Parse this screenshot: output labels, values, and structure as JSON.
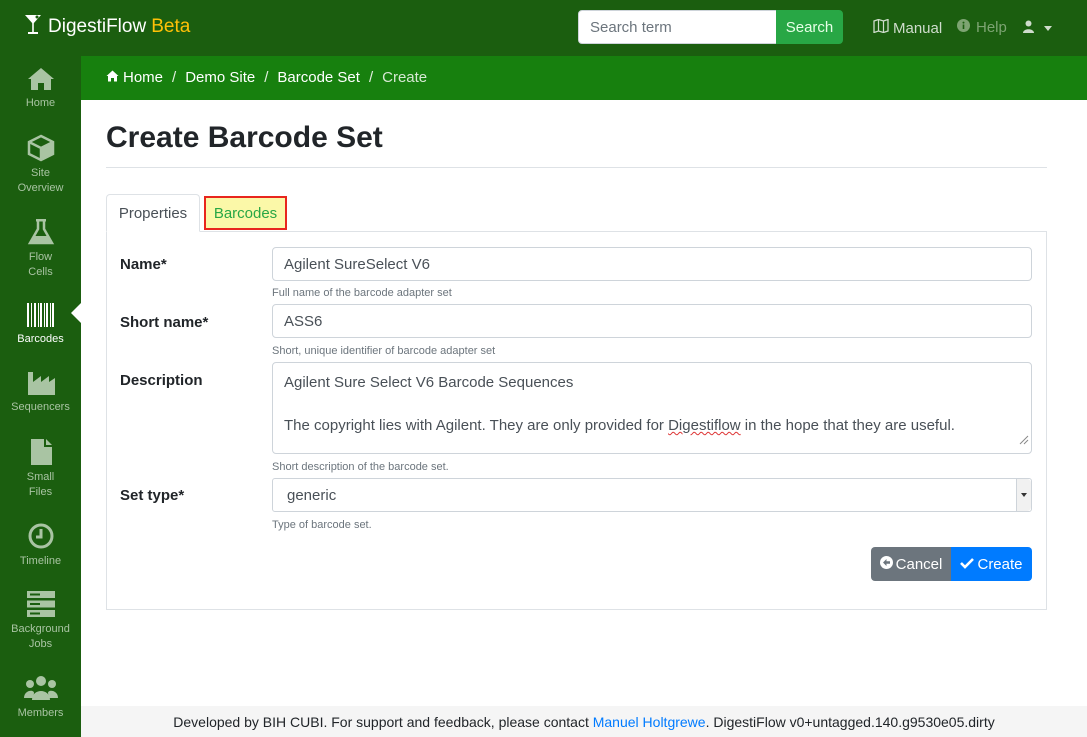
{
  "app": {
    "name": "DigestiFlow",
    "badge": "Beta"
  },
  "search": {
    "placeholder": "Search term",
    "button": "Search"
  },
  "topnav": {
    "manual": "Manual",
    "help": "Help"
  },
  "sidebar": {
    "items": [
      {
        "label1": "Home",
        "label2": "",
        "icon": "home-icon"
      },
      {
        "label1": "Site",
        "label2": "Overview",
        "icon": "cube-icon"
      },
      {
        "label1": "Flow",
        "label2": "Cells",
        "icon": "flask-icon"
      },
      {
        "label1": "Barcodes",
        "label2": "",
        "icon": "barcode-icon",
        "active": true
      },
      {
        "label1": "Sequencers",
        "label2": "",
        "icon": "industry-icon"
      },
      {
        "label1": "Small",
        "label2": "Files",
        "icon": "file-icon"
      },
      {
        "label1": "Timeline",
        "label2": "",
        "icon": "clock-icon"
      },
      {
        "label1": "Background",
        "label2": "Jobs",
        "icon": "server-icon"
      },
      {
        "label1": "Members",
        "label2": "",
        "icon": "users-icon"
      }
    ]
  },
  "breadcrumb": [
    "Home",
    "Demo Site",
    "Barcode Set",
    "Create"
  ],
  "page": {
    "title": "Create Barcode Set"
  },
  "tabs": {
    "properties": "Properties",
    "barcodes": "Barcodes"
  },
  "form": {
    "name": {
      "label": "Name*",
      "value": "Agilent SureSelect V6",
      "help": "Full name of the barcode adapter set"
    },
    "short_name": {
      "label": "Short name*",
      "value": "ASS6",
      "help": "Short, unique identifier of barcode adapter set"
    },
    "description": {
      "label": "Description",
      "line1": "Agilent Sure Select V6 Barcode Sequences",
      "line2_pre": "The copyright lies with Agilent. They are only provided for ",
      "line2_word": "Digestiflow",
      "line2_post": " in the hope that they are useful.",
      "help": "Short description of the barcode set."
    },
    "set_type": {
      "label": "Set type*",
      "value": "generic",
      "help": "Type of barcode set."
    }
  },
  "buttons": {
    "cancel": "Cancel",
    "create": "Create"
  },
  "footer": {
    "pre": "Developed by BIH CUBI. For support and feedback, please contact ",
    "link": "Manuel Holtgrewe",
    "post": ". DigestiFlow v0+untagged.140.g9530e05.dirty"
  },
  "colors": {
    "navbar": "#1b5e0f",
    "breadcrumb_bar": "#17800e",
    "brand_badge": "#ffc107",
    "primary": "#007bff",
    "secondary": "#6c757d",
    "success": "#28a745",
    "highlight_border": "#e8261d",
    "highlight_fill": "#fbf8a8"
  }
}
